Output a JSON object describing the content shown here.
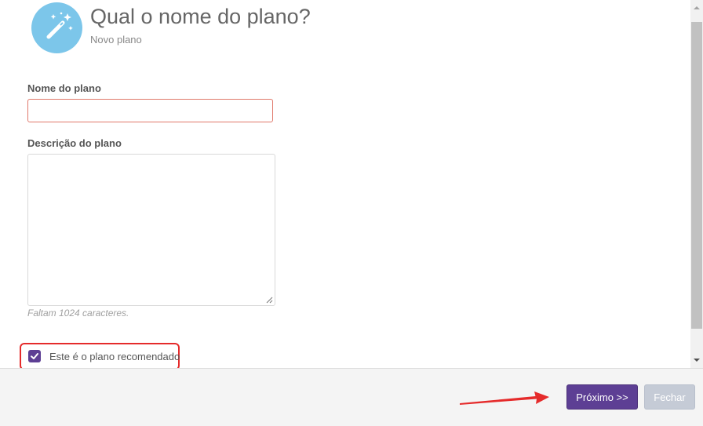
{
  "header": {
    "title": "Qual o nome do plano?",
    "subtitle": "Novo plano",
    "icon": "magic-wand-icon"
  },
  "form": {
    "name_label": "Nome do plano",
    "name_value": "",
    "description_label": "Descrição do plano",
    "description_value": "",
    "char_counter": "Faltam 1024 caracteres.",
    "recommended_label": "Este é o plano recomendado",
    "recommended_checked": true
  },
  "footer": {
    "next_label": "Próximo >>",
    "close_label": "Fechar"
  },
  "colors": {
    "accent": "#5d3f94",
    "avatar": "#7cc6ea",
    "annotation": "#e52b2b",
    "input_error_border": "#e0796b"
  }
}
